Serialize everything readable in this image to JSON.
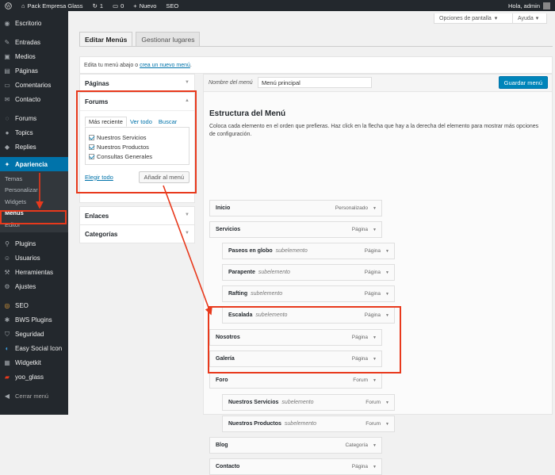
{
  "topbar": {
    "site": "Pack Empresa Glass",
    "updates": "1",
    "comments": "0",
    "new": "Nuevo",
    "seo": "SEO",
    "greeting": "Hola, admin"
  },
  "sidebar": {
    "items": [
      {
        "label": "Escritorio",
        "icon": "dashboard-icon"
      },
      {
        "label": "Entradas",
        "icon": "pin-icon"
      },
      {
        "label": "Medios",
        "icon": "media-icon"
      },
      {
        "label": "Páginas",
        "icon": "pages-icon"
      },
      {
        "label": "Comentarios",
        "icon": "comment-icon"
      },
      {
        "label": "Contacto",
        "icon": "mail-icon"
      },
      {
        "label": "Forums",
        "icon": "forums-icon"
      },
      {
        "label": "Topics",
        "icon": "topics-icon"
      },
      {
        "label": "Replies",
        "icon": "replies-icon"
      },
      {
        "label": "Apariencia",
        "icon": "brush-icon"
      }
    ],
    "submenu": [
      "Temas",
      "Personalizar",
      "Widgets",
      "Menús",
      "Editor"
    ],
    "items2": [
      {
        "label": "Plugins",
        "icon": "plugin-icon"
      },
      {
        "label": "Usuarios",
        "icon": "user-icon"
      },
      {
        "label": "Herramientas",
        "icon": "wrench-icon"
      },
      {
        "label": "Ajustes",
        "icon": "settings-icon"
      },
      {
        "label": "SEO",
        "icon": "seo-icon"
      },
      {
        "label": "BWS Plugins",
        "icon": "bws-icon"
      },
      {
        "label": "Seguridad",
        "icon": "shield-icon"
      },
      {
        "label": "Easy Social Icon",
        "icon": "social-icon"
      },
      {
        "label": "Widgetkit",
        "icon": "widgetkit-icon"
      },
      {
        "label": "yoo_glass",
        "icon": "yoo-icon"
      }
    ],
    "collapse": "Cerrar menú"
  },
  "screen_options": "Opciones de pantalla",
  "help": "Ayuda",
  "tabs": [
    "Editar Menús",
    "Gestionar lugares"
  ],
  "notice": {
    "text": "Edita tu menú abajo o ",
    "link": "crea un nuevo menú",
    "end": "."
  },
  "left": {
    "paginas": "Páginas",
    "forums": "Forums",
    "subtabs": [
      "Más reciente",
      "Ver todo",
      "Buscar"
    ],
    "checks": [
      "Nuestros Servicios",
      "Nuestros Productos",
      "Consultas Generales"
    ],
    "select_all": "Elegir todo",
    "add": "Añadir al menú",
    "enlaces": "Enlaces",
    "categorias": "Categorías"
  },
  "editor": {
    "name_label": "Nombre del menú",
    "name_value": "Menú principal",
    "save": "Guardar menú",
    "heading": "Estructura del Menú",
    "desc": "Coloca cada elemento en el orden que prefieras. Haz click en la flecha que hay a la derecha del elemento para mostrar más opciones de configuración.",
    "subword": "subelemento",
    "items": [
      {
        "label": "Inicio",
        "type": "Personalizado",
        "sub": false
      },
      {
        "label": "Servicios",
        "type": "Página",
        "sub": false
      },
      {
        "label": "Paseos en globo",
        "type": "Página",
        "sub": true
      },
      {
        "label": "Parapente",
        "type": "Página",
        "sub": true
      },
      {
        "label": "Rafting",
        "type": "Página",
        "sub": true
      },
      {
        "label": "Escalada",
        "type": "Página",
        "sub": true
      },
      {
        "label": "Nosotros",
        "type": "Página",
        "sub": false
      },
      {
        "label": "Galería",
        "type": "Página",
        "sub": false
      },
      {
        "label": "Foro",
        "type": "Forum",
        "sub": false
      },
      {
        "label": "Nuestros Servicios",
        "type": "Forum",
        "sub": true
      },
      {
        "label": "Nuestros Productos",
        "type": "Forum",
        "sub": true
      },
      {
        "label": "Blog",
        "type": "Categoría",
        "sub": false
      },
      {
        "label": "Contacto",
        "type": "Página",
        "sub": false
      }
    ]
  }
}
